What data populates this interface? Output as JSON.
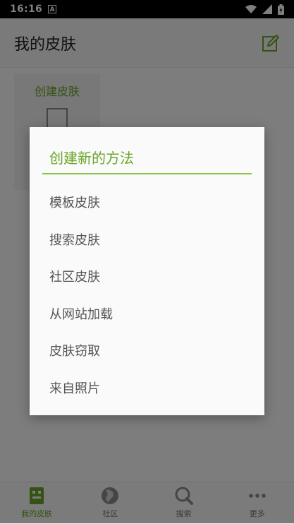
{
  "status": {
    "time": "16:16",
    "badge": "A"
  },
  "app_bar": {
    "title": "我的皮肤"
  },
  "card": {
    "title": "创建皮肤"
  },
  "bottom_nav": [
    {
      "label": "我的皮肤",
      "icon": "skin-icon",
      "active": true
    },
    {
      "label": "社区",
      "icon": "globe-icon",
      "active": false
    },
    {
      "label": "搜索",
      "icon": "search-icon",
      "active": false
    },
    {
      "label": "更多",
      "icon": "more-icon",
      "active": false
    }
  ],
  "dialog": {
    "title": "创建新的方法",
    "options": [
      "模板皮肤",
      "搜索皮肤",
      "社区皮肤",
      "从网站加载",
      "皮肤窃取",
      "来自照片"
    ]
  },
  "colors": {
    "accent": "#6aa528",
    "divider": "#8ac24a"
  }
}
